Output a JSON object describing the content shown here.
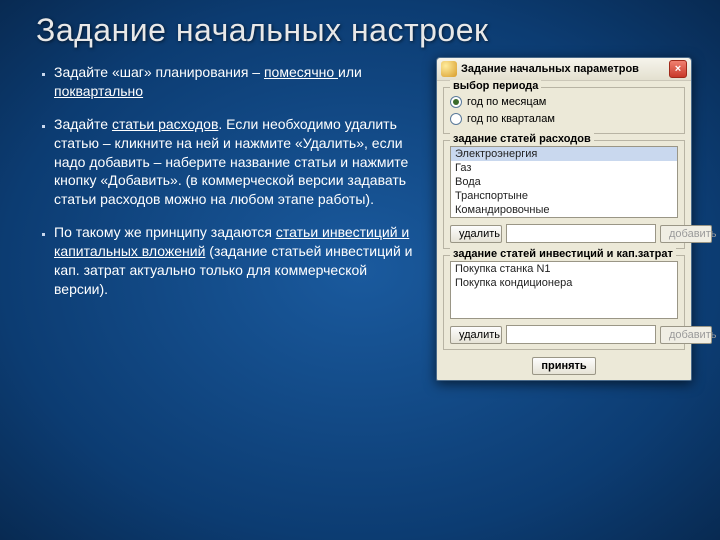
{
  "slide": {
    "title": "Задание начальных настроек",
    "bullets": [
      {
        "pre": "Задайте «шаг» планирования – ",
        "u1": "помесячно ",
        "mid": "или ",
        "u2": "поквартально"
      },
      {
        "pre": "Задайте ",
        "u1": "статьи расходов",
        "post": ". Если необходимо удалить статью – кликните на ней и нажмите «Удалить», если надо добавить – наберите название статьи и нажмите кнопку «Добавить». (в коммерческой версии задавать статьи расходов можно на любом этапе работы)."
      },
      {
        "pre": "По такому же принципу задаются ",
        "u1": "статьи инвестиций и капитальных вложений",
        "post": " (задание статьей инвестиций и кап. затрат актуально только для коммерческой версии)."
      }
    ]
  },
  "window": {
    "title": "Задание начальных параметров",
    "close_x": "×",
    "period": {
      "legend": "выбор периода",
      "opt_months": "год по месяцам",
      "opt_quarters": "год по кварталам",
      "selected": "months"
    },
    "expenses": {
      "legend": "задание статей расходов",
      "items": [
        "Электроэнергия",
        "Газ",
        "Вода",
        "Транспортыне",
        "Командировочные"
      ],
      "delete_label": "удалить",
      "add_label": "добавить",
      "input_value": ""
    },
    "invest": {
      "legend": "задание статей инвестиций и кап.затрат",
      "items": [
        "Покупка станка N1",
        "Покупка кондиционера"
      ],
      "delete_label": "удалить",
      "add_label": "добавить",
      "input_value": ""
    },
    "accept_label": "принять"
  }
}
